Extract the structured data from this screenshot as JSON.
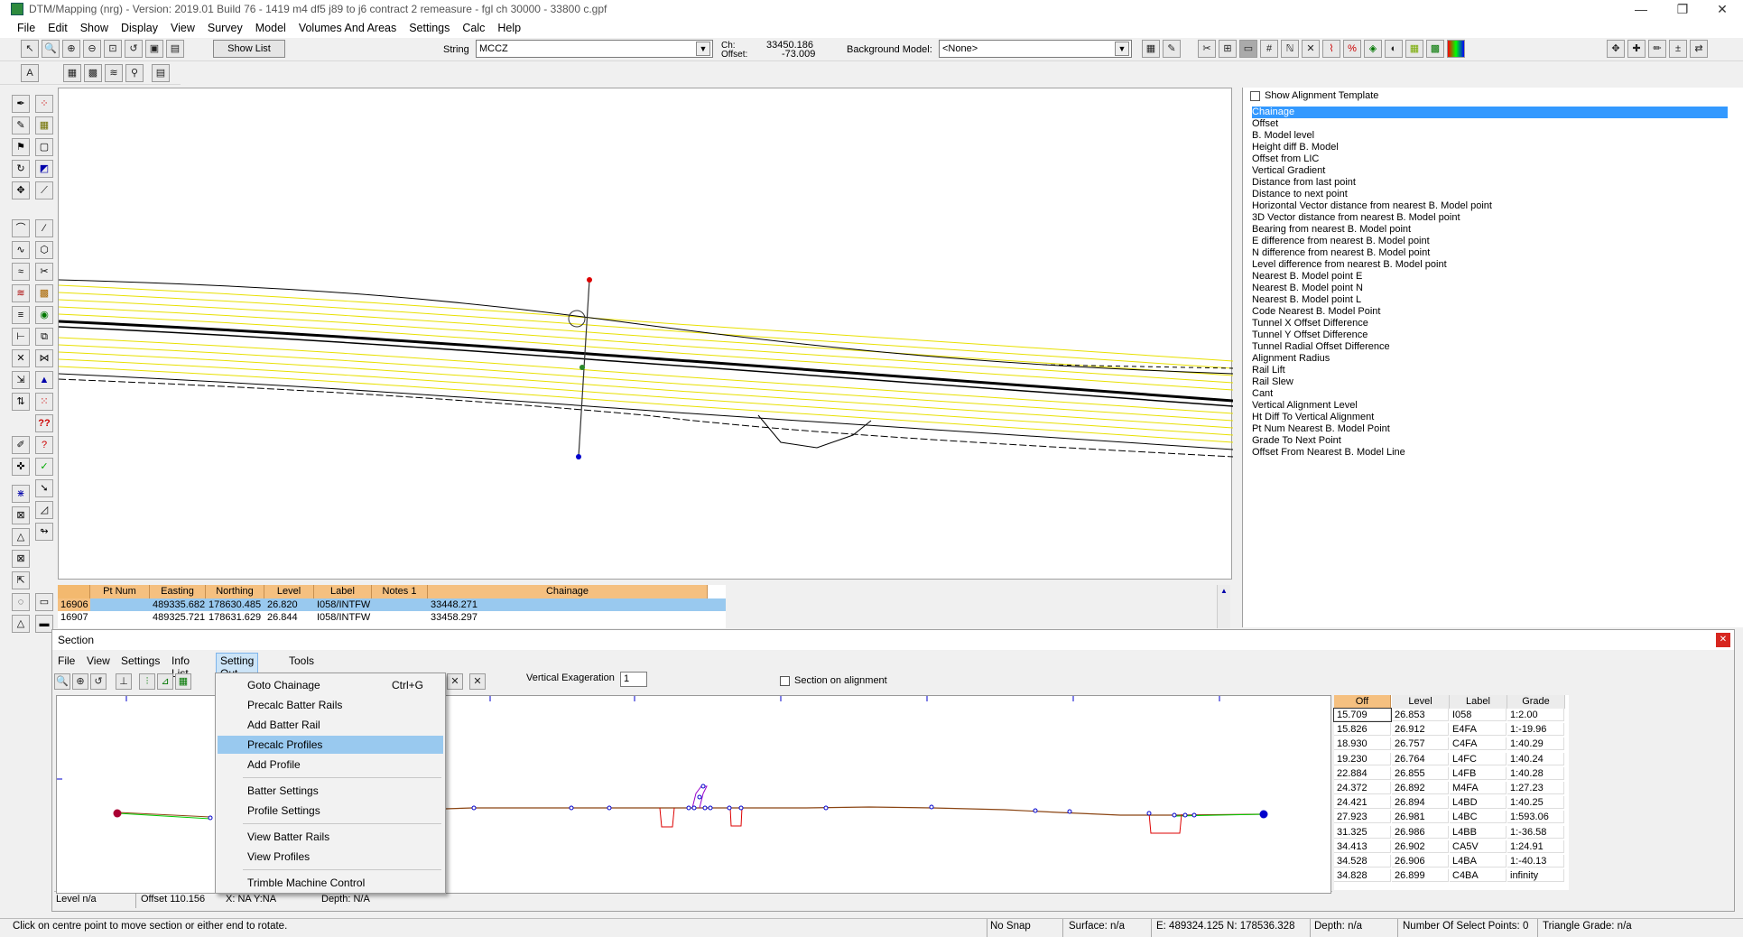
{
  "window": {
    "title": "DTM/Mapping (nrg) - Version: 2019.01 Build 76 - 1419 m4 df5 j89 to j6 contract 2 remeasure - fgl ch 30000 - 33800 c.gpf",
    "minimize": "—",
    "maximize": "❐",
    "close": "✕"
  },
  "menubar": [
    "File",
    "Edit",
    "Show",
    "Display",
    "View",
    "Survey",
    "Model",
    "Volumes And Areas",
    "Settings",
    "Calc",
    "Help"
  ],
  "toolbar": {
    "show_list": "Show List",
    "string_label": "String",
    "string_value": "MCCZ",
    "ch_label": "Ch:",
    "offset_label": "Offset:",
    "ch_value": "33450.186",
    "offset_value": "-73.009",
    "background_model_label": "Background Model:",
    "background_model_value": "<None>"
  },
  "icons": {
    "arrow": "pointer-icon",
    "zoom": "zoom-icon"
  },
  "right_panel": {
    "show_alignment_template": "Show Alignment Template",
    "items": [
      "Chainage",
      "Offset",
      "B. Model level",
      "Height diff B. Model",
      "Offset from LIC",
      "Vertical Gradient",
      "Distance from last point",
      "Distance to next point",
      "Horizontal Vector distance from nearest B. Model point",
      "3D Vector distance from nearest B. Model point",
      "Bearing from nearest B. Model point",
      "E difference from nearest B. Model point",
      "N difference from nearest B. Model point",
      "Level difference from nearest B. Model point",
      "Nearest B. Model point E",
      "Nearest B. Model point N",
      "Nearest B. Model point L",
      "Code Nearest B. Model Point",
      "Tunnel X Offset Difference",
      "Tunnel Y Offset Difference",
      "Tunnel Radial Offset Difference",
      "Alignment Radius",
      "Rail Lift",
      "Rail Slew",
      "Cant",
      "Vertical Alignment Level",
      "Ht Diff To Vertical Alignment",
      "Pt Num Nearest B. Model Point",
      "Grade To Next Point",
      "Offset From Nearest B. Model Line"
    ],
    "selected_index": 0
  },
  "point_table": {
    "headers": [
      "Pt Num",
      "Easting",
      "Northing",
      "Level",
      "Label",
      "Notes 1",
      "Chainage"
    ],
    "rows": [
      [
        "16906",
        "489335.682",
        "178630.485",
        "26.820",
        "I058/INTFW",
        "",
        "33448.271"
      ],
      [
        "16907",
        "489325.721",
        "178631.629",
        "26.844",
        "I058/INTFW",
        "",
        "33458.297"
      ]
    ]
  },
  "section": {
    "title": "Section",
    "close": "✕",
    "menu": [
      "File",
      "View",
      "Settings",
      "Info List",
      "Setting Out",
      "Tools"
    ],
    "vertical_exaggeration_label": "Vertical Exageration",
    "vertical_exaggeration_value": "1",
    "section_on_alignment": "Section on alignment",
    "level_status": "Level n/a",
    "offset_status": "Offset 110.156",
    "xy_status": "X: NA  Y:NA",
    "depth_status": "Depth: N/A",
    "table": {
      "headers": [
        "Off",
        "Level",
        "Label",
        "Grade"
      ],
      "rows": [
        [
          "15.709",
          "26.853",
          "I058",
          "1:2.00"
        ],
        [
          "15.826",
          "26.912",
          "E4FA",
          "1:-19.96"
        ],
        [
          "18.930",
          "26.757",
          "C4FA",
          "1:40.29"
        ],
        [
          "19.230",
          "26.764",
          "L4FC",
          "1:40.24"
        ],
        [
          "22.884",
          "26.855",
          "L4FB",
          "1:40.28"
        ],
        [
          "24.372",
          "26.892",
          "M4FA",
          "1:27.23"
        ],
        [
          "24.421",
          "26.894",
          "L4BD",
          "1:40.25"
        ],
        [
          "27.923",
          "26.981",
          "L4BC",
          "1:593.06"
        ],
        [
          "31.325",
          "26.986",
          "L4BB",
          "1:-36.58"
        ],
        [
          "34.413",
          "26.902",
          "CA5V",
          "1:24.91"
        ],
        [
          "34.528",
          "26.906",
          "L4BA",
          "1:-40.13"
        ],
        [
          "34.828",
          "26.899",
          "C4BA",
          "infinity"
        ]
      ]
    }
  },
  "dropdown": {
    "items": [
      {
        "label": "Goto Chainage",
        "shortcut": "Ctrl+G"
      },
      {
        "label": "Precalc Batter Rails",
        "shortcut": ""
      },
      {
        "label": "Add Batter Rail",
        "shortcut": ""
      },
      {
        "label": "Precalc Profiles",
        "shortcut": ""
      },
      {
        "label": "Add Profile",
        "shortcut": ""
      },
      {
        "label": "Batter Settings",
        "shortcut": ""
      },
      {
        "label": "Profile Settings",
        "shortcut": ""
      },
      {
        "label": "View Batter Rails",
        "shortcut": ""
      },
      {
        "label": "View Profiles",
        "shortcut": ""
      },
      {
        "label": "Trimble Machine Control",
        "shortcut": ""
      }
    ],
    "highlighted_index": 3
  },
  "statusbar": {
    "hint": "Click on centre point to move section or either end to rotate.",
    "snap": "No Snap",
    "surface": "Surface: n/a",
    "coords": "E: 489324.125  N: 178536.328",
    "depth": "Depth: n/a",
    "select_points": "Number Of Select Points: 0",
    "triangle_grade": "Triangle Grade: n/a"
  },
  "colors": {
    "selection_blue": "#3399ff",
    "highlight_blue": "#99c9ef",
    "header_orange": "#f5c080",
    "yellow_lines": "#e8e000",
    "section_line": "#8b4513",
    "batter_green": "#00cc00",
    "red_marker": "#dd0000",
    "blue_marker": "#0000cc"
  }
}
